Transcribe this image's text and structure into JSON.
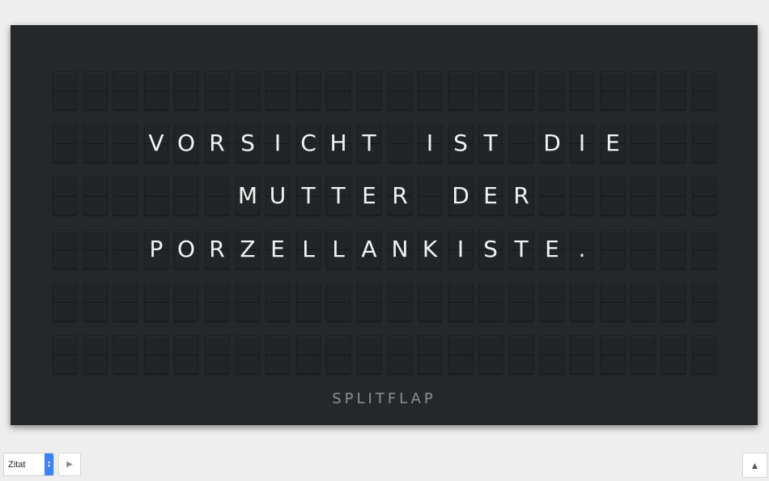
{
  "board": {
    "rows": 6,
    "cols": 22,
    "lines": [
      "",
      "VORSICHT IST DIE",
      "MUTTER DER",
      "PORZELLANKISTE.",
      "",
      ""
    ],
    "brand": "SPLITFLAP"
  },
  "controls": {
    "mode_select": {
      "value": "Zitat"
    },
    "play_icon": "▶",
    "scroll_top_icon": "▲"
  },
  "colors": {
    "board": "#25282b",
    "flap": "#222527",
    "letter": "#f2f2f2",
    "brand": "#8d9093",
    "page": "#eeeeee"
  }
}
